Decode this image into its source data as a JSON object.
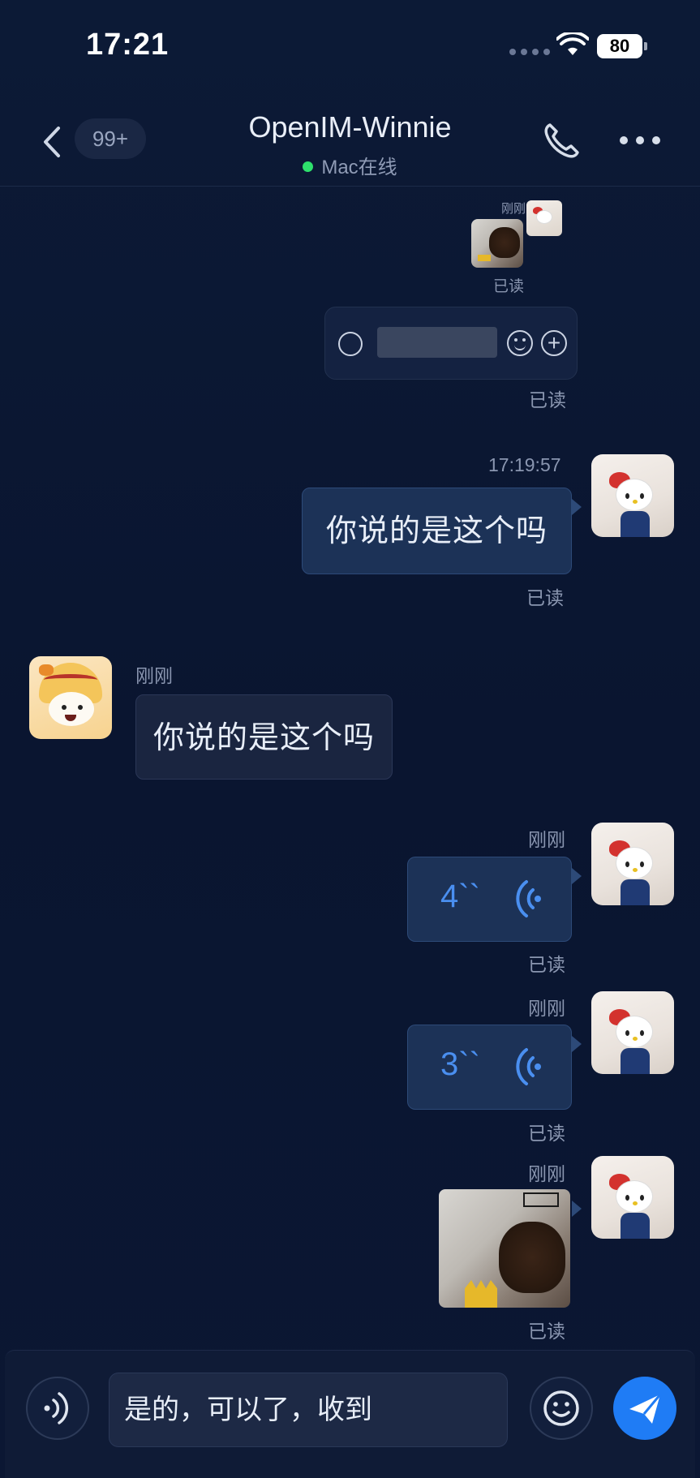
{
  "status_bar": {
    "time": "17:21",
    "battery": "80"
  },
  "header": {
    "unread_count": "99+",
    "title": "OpenIM-Winnie",
    "presence": "Mac在线"
  },
  "messages": {
    "top_sender_label": "刚刚",
    "top_read": "已读",
    "quoted_read": "已读",
    "msg1": {
      "time": "17:19:57",
      "text": "你说的是这个吗",
      "read": "已读"
    },
    "msg2": {
      "sender_time": "刚刚",
      "text": "你说的是这个吗"
    },
    "voice1": {
      "time": "刚刚",
      "duration": "4``",
      "read": "已读"
    },
    "voice2": {
      "time": "刚刚",
      "duration": "3``",
      "read": "已读"
    },
    "image1": {
      "time": "刚刚",
      "read": "已读"
    }
  },
  "input": {
    "value": "是的，可以了，收到"
  },
  "colors": {
    "accent": "#1f7cf5",
    "online": "#2ee06c",
    "voice": "#4a8ff0"
  }
}
